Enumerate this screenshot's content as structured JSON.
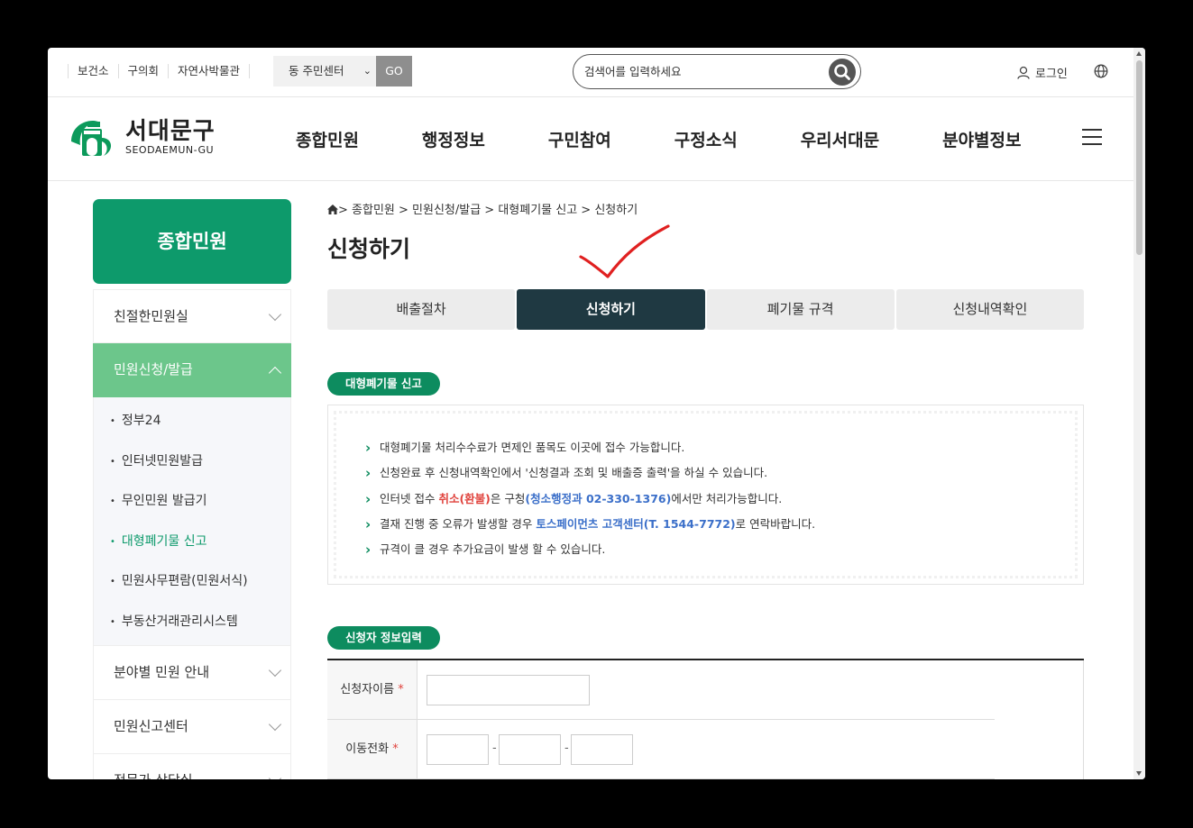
{
  "topbar": {
    "links": [
      "보건소",
      "구의회",
      "자연사박물관"
    ],
    "dong_select": "동 주민센터",
    "go_label": "GO",
    "search_placeholder": "검색어를 입력하세요",
    "login_label": "로그인"
  },
  "logo": {
    "kr": "서대문구",
    "en": "SEODAEMUN-GU"
  },
  "nav": {
    "items": [
      "종합민원",
      "행정정보",
      "구민참여",
      "구정소식",
      "우리서대문",
      "분야별정보"
    ]
  },
  "sidebar": {
    "title": "종합민원",
    "items": [
      {
        "label": "친절한민원실"
      },
      {
        "label": "민원신청/발급"
      },
      {
        "label": "분야별 민원 안내"
      },
      {
        "label": "민원신고센터"
      },
      {
        "label": "전문가 상담실"
      }
    ],
    "sub_items": [
      "정부24",
      "인터넷민원발급",
      "무인민원 발급기",
      "대형폐기물 신고",
      "민원사무편람(민원서식)",
      "부동산거래관리시스템"
    ]
  },
  "breadcrumb": "> 종합민원 > 민원신청/발급 > 대형폐기물 신고 > 신청하기",
  "page_title": "신청하기",
  "tabs": [
    "배출절차",
    "신청하기",
    "폐기물 규격",
    "신청내역확인"
  ],
  "section1": {
    "title": "대형폐기물 신고",
    "lines": {
      "l1": "대형폐기물 처리수수료가 면제인 품목도 이곳에 접수 가능합니다.",
      "l2": "신청완료 후 신청내역확인에서 '신청결과 조회 및 배출증 출력'을 하실 수 있습니다.",
      "l3_a": "인터넷 접수 ",
      "l3_b": "취소(환불)",
      "l3_c": "은 구청",
      "l3_d": "(청소행정과 02-330-1376)",
      "l3_e": "에서만 처리가능합니다.",
      "l4_a": "결재 진행 중 오류가 발생할 경우 ",
      "l4_b": "토스페이먼츠 고객센터(T. 1544-7772)",
      "l4_c": "로 연락바랍니다.",
      "l5": "규격이 클 경우 추가요금이 발생 할 수 있습니다."
    }
  },
  "section2": {
    "title": "신청자 정보입력",
    "name_label": "신청자이름",
    "phone_label": "이동전화",
    "required_mark": "*",
    "dash": "-"
  },
  "colors": {
    "green": "#0d9a6b",
    "tab_active": "#1f3942",
    "check": "#e02020"
  }
}
